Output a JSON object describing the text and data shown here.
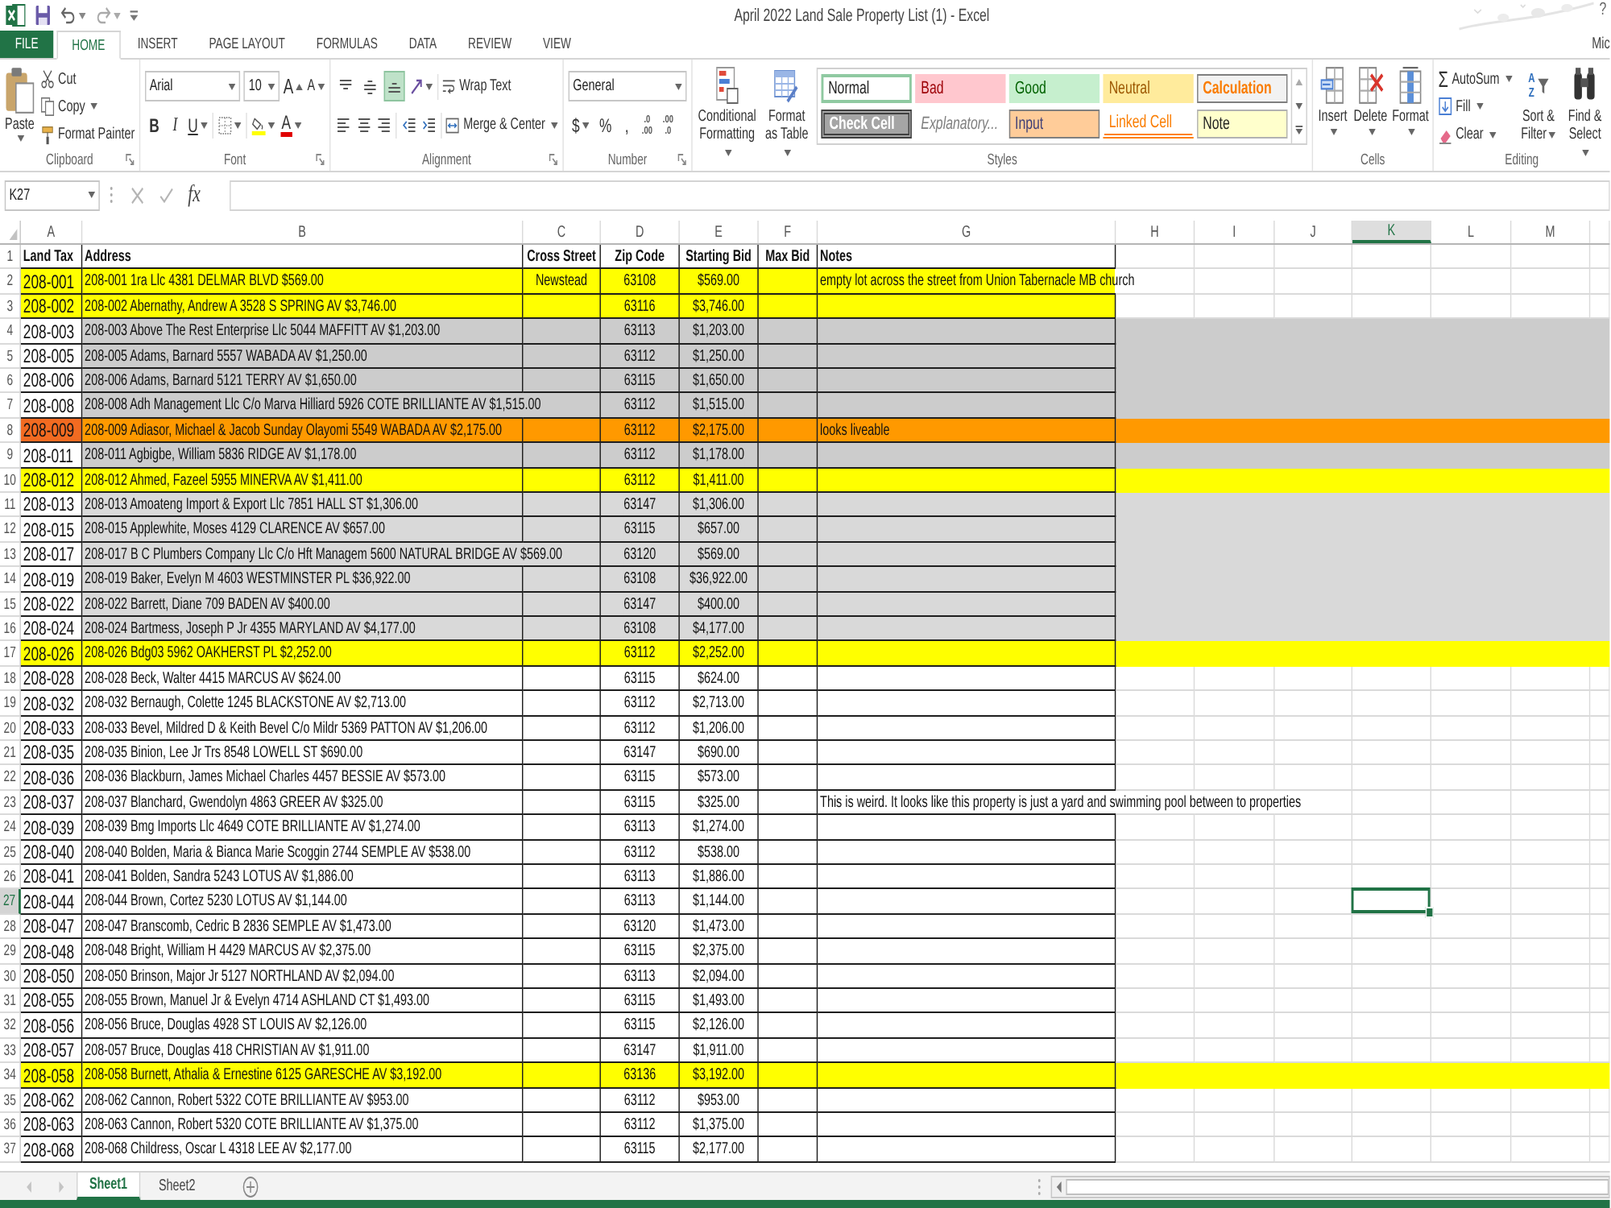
{
  "title_bar": {
    "title": "April 2022 Land Sale Property List (1) - Excel",
    "help": "?"
  },
  "ribbon_tabs": [
    {
      "label": "FILE",
      "kind": "file",
      "selected": false
    },
    {
      "label": "HOME",
      "kind": "tab",
      "selected": true
    },
    {
      "label": "INSERT",
      "kind": "tab",
      "selected": false
    },
    {
      "label": "PAGE LAYOUT",
      "kind": "tab",
      "selected": false
    },
    {
      "label": "FORMULAS",
      "kind": "tab",
      "selected": false
    },
    {
      "label": "DATA",
      "kind": "tab",
      "selected": false
    },
    {
      "label": "REVIEW",
      "kind": "tab",
      "selected": false
    },
    {
      "label": "VIEW",
      "kind": "tab",
      "selected": false
    }
  ],
  "account": "Mic",
  "ribbon": {
    "clipboard": {
      "paste": "Paste",
      "cut": "Cut",
      "copy": "Copy",
      "format_painter": "Format Painter",
      "label": "Clipboard"
    },
    "font": {
      "name": "Arial",
      "size": "10",
      "grow": "A",
      "shrink": "A",
      "bold": "B",
      "italic": "I",
      "underline": "U",
      "font_tint": "A",
      "label": "Font"
    },
    "alignment": {
      "vertical": [
        {
          "kind": "top",
          "selected": false
        },
        {
          "kind": "middle",
          "selected": false
        },
        {
          "kind": "bottom",
          "selected": true
        }
      ],
      "wrap_text": "Wrap Text",
      "merge": "Merge & Center",
      "label": "Alignment"
    },
    "number": {
      "format": "General",
      "currency": "$",
      "percent": "%",
      "comma": ",",
      "increase_decimal": [
        ".0",
        ".00"
      ],
      "decrease_decimal": [
        ".00",
        ".0"
      ],
      "label": "Number"
    },
    "styles": {
      "conditional": "Conditional Formatting",
      "format_table": "Format as Table",
      "gallery": [
        {
          "label": "Normal",
          "kind": "normal",
          "selected": true
        },
        {
          "label": "Bad",
          "kind": "bad",
          "selected": false
        },
        {
          "label": "Good",
          "kind": "good",
          "selected": false
        },
        {
          "label": "Neutral",
          "kind": "neutral",
          "selected": false
        },
        {
          "label": "Calculation",
          "kind": "calculation",
          "selected": false
        },
        {
          "label": "Check Cell",
          "kind": "check",
          "selected": false
        },
        {
          "label": "Explanatory...",
          "kind": "explanatory",
          "selected": false
        },
        {
          "label": "Input",
          "kind": "input",
          "selected": false
        },
        {
          "label": "Linked Cell",
          "kind": "linked",
          "selected": false
        },
        {
          "label": "Note",
          "kind": "note",
          "selected": false
        }
      ],
      "label": "Styles"
    },
    "cells": {
      "buttons": [
        {
          "label": "Insert",
          "kind": "insert"
        },
        {
          "label": "Delete",
          "kind": "delete"
        },
        {
          "label": "Format",
          "kind": "format"
        }
      ],
      "label": "Cells"
    },
    "editing": {
      "autosum_sign": "Σ",
      "autosum": "AutoSum",
      "fill": "Fill",
      "clear": "Clear",
      "sort_letters": "A Z",
      "sort": "Sort & Filter",
      "find": "Find & Select",
      "label": "Editing"
    }
  },
  "formula_bar": {
    "name_box": "K27",
    "fx": "fx"
  },
  "sheet": {
    "columns": [
      {
        "letter": "A",
        "selected": false
      },
      {
        "letter": "B",
        "selected": false
      },
      {
        "letter": "C",
        "selected": false
      },
      {
        "letter": "D",
        "selected": false
      },
      {
        "letter": "E",
        "selected": false
      },
      {
        "letter": "F",
        "selected": false
      },
      {
        "letter": "G",
        "selected": false
      },
      {
        "letter": "H",
        "selected": false
      },
      {
        "letter": "I",
        "selected": false
      },
      {
        "letter": "J",
        "selected": false
      },
      {
        "letter": "K",
        "selected": true
      },
      {
        "letter": "L",
        "selected": false
      },
      {
        "letter": "M",
        "selected": false
      }
    ],
    "header_row": {
      "number": "1",
      "land_tax": "Land Tax",
      "address": "Address",
      "cross_street": "Cross Street",
      "zip_code": "Zip Code",
      "starting_bid": "Starting Bid",
      "max_bid": "Max Bid",
      "notes": "Notes"
    },
    "rows": [
      {
        "number": "2",
        "land_tax": {
          "value": "208-001",
          "color": "#ffff00"
        },
        "address": "208-001 1ra Llc 4381 DELMAR BLVD $569.00",
        "cross_street": "Newstead",
        "zip_code": "63108",
        "starting_bid": "$569.00",
        "notes": "empty lot across the street from Union Tabernacle MB church",
        "color": "#ffff00",
        "full_row": false,
        "selected": false
      },
      {
        "number": "3",
        "land_tax": {
          "value": "208-002",
          "color": "#ffff00"
        },
        "address": "208-002 Abernathy, Andrew A 3528 S SPRING AV $3,746.00",
        "zip_code": "63116",
        "starting_bid": "$3,746.00",
        "color": "#ffff00",
        "full_row": false,
        "selected": false
      },
      {
        "number": "4",
        "land_tax": {
          "value": "208-003"
        },
        "address": "208-003 Above The Rest Enterprise Llc 5044 MAFFITT AV $1,203.00",
        "zip_code": "63113",
        "starting_bid": "$1,203.00",
        "color": "#cccccc",
        "full_row": true,
        "selected": false
      },
      {
        "number": "5",
        "land_tax": {
          "value": "208-005"
        },
        "address": "208-005 Adams, Barnard 5557 WABADA AV $1,250.00",
        "zip_code": "63112",
        "starting_bid": "$1,250.00",
        "color": "#cccccc",
        "full_row": true,
        "selected": false
      },
      {
        "number": "6",
        "land_tax": {
          "value": "208-006"
        },
        "address": "208-006 Adams, Barnard 5121 TERRY AV $1,650.00",
        "zip_code": "63115",
        "starting_bid": "$1,650.00",
        "color": "#cccccc",
        "full_row": true,
        "selected": false
      },
      {
        "number": "7",
        "land_tax": {
          "value": "208-008"
        },
        "address": "208-008 Adh Management Llc C/o Marva Hilliard 5926 COTE BRILLIANTE AV $1,515.00",
        "zip_code": "63112",
        "starting_bid": "$1,515.00",
        "color": "#cccccc",
        "full_row": true,
        "selected": false
      },
      {
        "number": "8",
        "land_tax": {
          "value": "208-009",
          "color": "#f26b21"
        },
        "address": "208-009 Adiasor, Michael & Jacob Sunday Olayomi 5549 WABADA AV $2,175.00",
        "zip_code": "63112",
        "starting_bid": "$2,175.00",
        "notes": "looks liveable",
        "color": "#ff9900",
        "full_row": true,
        "selected": false
      },
      {
        "number": "9",
        "land_tax": {
          "value": "208-011"
        },
        "address": "208-011 Agbigbe, William 5836 RIDGE AV $1,178.00",
        "zip_code": "63112",
        "starting_bid": "$1,178.00",
        "color": "#cccccc",
        "full_row": true,
        "selected": false
      },
      {
        "number": "10",
        "land_tax": {
          "value": "208-012",
          "color": "#ffff00"
        },
        "address": "208-012 Ahmed, Fazeel 5955 MINERVA AV $1,411.00",
        "zip_code": "63112",
        "starting_bid": "$1,411.00",
        "color": "#ffff00",
        "full_row": true,
        "selected": false
      },
      {
        "number": "11",
        "land_tax": {
          "value": "208-013"
        },
        "address": "208-013 Amoateng Import & Export Llc 7851 HALL ST $1,306.00",
        "zip_code": "63147",
        "starting_bid": "$1,306.00",
        "color": "#d9d9d9",
        "full_row": true,
        "selected": false
      },
      {
        "number": "12",
        "land_tax": {
          "value": "208-015"
        },
        "address": "208-015 Applewhite, Moses 4129 CLARENCE AV $657.00",
        "zip_code": "63115",
        "starting_bid": "$657.00",
        "color": "#d9d9d9",
        "full_row": true,
        "selected": false
      },
      {
        "number": "13",
        "land_tax": {
          "value": "208-017"
        },
        "address": "208-017 B C Plumbers Company Llc C/o Hft Managem 5600 NATURAL BRIDGE AV $569.00",
        "zip_code": "63120",
        "starting_bid": "$569.00",
        "color": "#d9d9d9",
        "full_row": true,
        "selected": false
      },
      {
        "number": "14",
        "land_tax": {
          "value": "208-019"
        },
        "address": "208-019 Baker, Evelyn M 4603 WESTMINSTER PL $36,922.00",
        "zip_code": "63108",
        "starting_bid": "$36,922.00",
        "color": "#d9d9d9",
        "full_row": true,
        "selected": false
      },
      {
        "number": "15",
        "land_tax": {
          "value": "208-022"
        },
        "address": "208-022 Barrett, Diane 709 BADEN AV $400.00",
        "zip_code": "63147",
        "starting_bid": "$400.00",
        "color": "#d9d9d9",
        "full_row": true,
        "selected": false
      },
      {
        "number": "16",
        "land_tax": {
          "value": "208-024"
        },
        "address": "208-024 Bartmess, Joseph P Jr 4355 MARYLAND AV $4,177.00",
        "zip_code": "63108",
        "starting_bid": "$4,177.00",
        "color": "#d9d9d9",
        "full_row": true,
        "selected": false
      },
      {
        "number": "17",
        "land_tax": {
          "value": "208-026",
          "color": "#ffff00"
        },
        "address": "208-026 Bdg03 5962 OAKHERST PL $2,252.00",
        "zip_code": "63112",
        "starting_bid": "$2,252.00",
        "color": "#ffff00",
        "full_row": true,
        "selected": false
      },
      {
        "number": "18",
        "land_tax": {
          "value": "208-028"
        },
        "address": "208-028 Beck, Walter 4415 MARCUS AV $624.00",
        "zip_code": "63115",
        "starting_bid": "$624.00",
        "full_row": false,
        "selected": false
      },
      {
        "number": "19",
        "land_tax": {
          "value": "208-032"
        },
        "address": "208-032 Bernaugh, Colette 1245 BLACKSTONE AV $2,713.00",
        "zip_code": "63112",
        "starting_bid": "$2,713.00",
        "full_row": false,
        "selected": false
      },
      {
        "number": "20",
        "land_tax": {
          "value": "208-033"
        },
        "address": "208-033 Bevel, Mildred D & Keith Bevel C/o Mildr 5369 PATTON AV $1,206.00",
        "zip_code": "63112",
        "starting_bid": "$1,206.00",
        "full_row": false,
        "selected": false
      },
      {
        "number": "21",
        "land_tax": {
          "value": "208-035"
        },
        "address": "208-035 Binion, Lee Jr Trs 8548 LOWELL ST $690.00",
        "zip_code": "63147",
        "starting_bid": "$690.00",
        "full_row": false,
        "selected": false
      },
      {
        "number": "22",
        "land_tax": {
          "value": "208-036"
        },
        "address": "208-036 Blackburn, James Michael Charles 4457 BESSIE AV $573.00",
        "zip_code": "63115",
        "starting_bid": "$573.00",
        "full_row": false,
        "selected": false
      },
      {
        "number": "23",
        "land_tax": {
          "value": "208-037"
        },
        "address": "208-037 Blanchard, Gwendolyn 4863 GREER AV $325.00",
        "zip_code": "63115",
        "starting_bid": "$325.00",
        "notes": "This is weird. It looks like this property is just a yard and swimming pool between to properties",
        "full_row": false,
        "selected": false
      },
      {
        "number": "24",
        "land_tax": {
          "value": "208-039"
        },
        "address": "208-039 Bmg Imports Llc 4649 COTE BRILLIANTE AV $1,274.00",
        "zip_code": "63113",
        "starting_bid": "$1,274.00",
        "full_row": false,
        "selected": false
      },
      {
        "number": "25",
        "land_tax": {
          "value": "208-040"
        },
        "address": "208-040 Bolden, Maria & Bianca Marie Scoggin 2744 SEMPLE AV $538.00",
        "zip_code": "63112",
        "starting_bid": "$538.00",
        "full_row": false,
        "selected": false
      },
      {
        "number": "26",
        "land_tax": {
          "value": "208-041"
        },
        "address": "208-041 Bolden, Sandra 5243 LOTUS AV $1,886.00",
        "zip_code": "63113",
        "starting_bid": "$1,886.00",
        "full_row": false,
        "selected": false
      },
      {
        "number": "27",
        "land_tax": {
          "value": "208-044"
        },
        "address": "208-044 Brown, Cortez 5230 LOTUS AV $1,144.00",
        "zip_code": "63113",
        "starting_bid": "$1,144.00",
        "full_row": false,
        "selected": true
      },
      {
        "number": "28",
        "land_tax": {
          "value": "208-047"
        },
        "address": "208-047 Branscomb, Cedric B 2836 SEMPLE AV $1,473.00",
        "zip_code": "63120",
        "starting_bid": "$1,473.00",
        "full_row": false,
        "selected": false
      },
      {
        "number": "29",
        "land_tax": {
          "value": "208-048"
        },
        "address": "208-048 Bright, William H 4429 MARCUS AV $2,375.00",
        "zip_code": "63115",
        "starting_bid": "$2,375.00",
        "full_row": false,
        "selected": false
      },
      {
        "number": "30",
        "land_tax": {
          "value": "208-050"
        },
        "address": "208-050 Brinson, Major Jr 5127 NORTHLAND AV $2,094.00",
        "zip_code": "63113",
        "starting_bid": "$2,094.00",
        "full_row": false,
        "selected": false
      },
      {
        "number": "31",
        "land_tax": {
          "value": "208-055"
        },
        "address": "208-055 Brown, Manuel Jr & Evelyn 4714 ASHLAND CT $1,493.00",
        "zip_code": "63115",
        "starting_bid": "$1,493.00",
        "full_row": false,
        "selected": false
      },
      {
        "number": "32",
        "land_tax": {
          "value": "208-056"
        },
        "address": "208-056 Bruce, Douglas 4928 ST LOUIS AV $2,126.00",
        "zip_code": "63115",
        "starting_bid": "$2,126.00",
        "full_row": false,
        "selected": false
      },
      {
        "number": "33",
        "land_tax": {
          "value": "208-057"
        },
        "address": "208-057 Bruce, Douglas 418 CHRISTIAN AV $1,911.00",
        "zip_code": "63147",
        "starting_bid": "$1,911.00",
        "full_row": false,
        "selected": false
      },
      {
        "number": "34",
        "land_tax": {
          "value": "208-058",
          "color": "#ffff00"
        },
        "address": "208-058 Burnett, Athalia & Ernestine 6125 GARESCHE AV $3,192.00",
        "zip_code": "63136",
        "starting_bid": "$3,192.00",
        "color": "#ffff00",
        "full_row": true,
        "selected": false
      },
      {
        "number": "35",
        "land_tax": {
          "value": "208-062"
        },
        "address": "208-062 Cannon, Robert 5322 COTE BRILLIANTE AV $953.00",
        "zip_code": "63112",
        "starting_bid": "$953.00",
        "full_row": false,
        "selected": false
      },
      {
        "number": "36",
        "land_tax": {
          "value": "208-063"
        },
        "address": "208-063 Cannon, Robert 5320 COTE BRILLIANTE AV $1,375.00",
        "zip_code": "63112",
        "starting_bid": "$1,375.00",
        "full_row": false,
        "selected": false
      },
      {
        "number": "37",
        "land_tax": {
          "value": "208-068"
        },
        "address": "208-068 Childress, Oscar L 4318 LEE AV $2,177.00",
        "zip_code": "63115",
        "starting_bid": "$2,177.00",
        "full_row": false,
        "selected": false
      }
    ]
  },
  "sheet_tabs": [
    {
      "label": "Sheet1",
      "selected": true
    },
    {
      "label": "Sheet2",
      "selected": false
    }
  ]
}
